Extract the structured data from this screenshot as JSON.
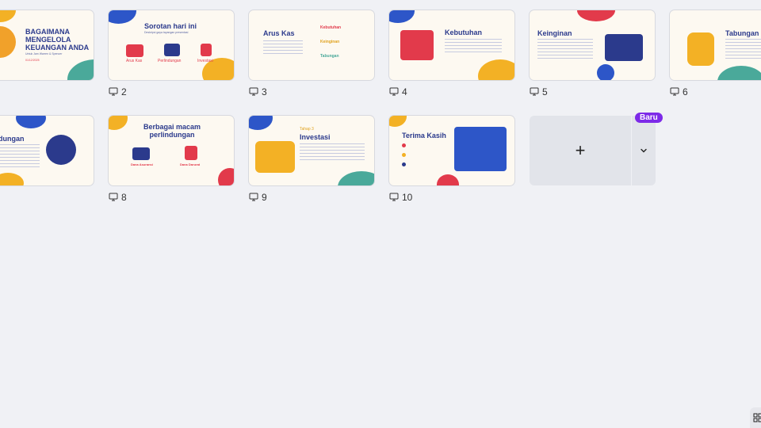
{
  "slides": [
    {
      "number": "",
      "title": "BAGAIMANA MENGELOLA KEUANGAN ANDA",
      "subtitle": "Untuk Jam Warren & Spencer",
      "date": "01/12/2025"
    },
    {
      "number": "2",
      "title": "Sorotan hari ini",
      "subtitle": "Deskripsi gaya tayangan presentasi",
      "labels": [
        "Arus Kas",
        "Perlindungan",
        "Investasi"
      ]
    },
    {
      "number": "3",
      "title": "Arus Kas",
      "labels": [
        "Kebutuhan",
        "Keinginan",
        "Tabungan"
      ]
    },
    {
      "number": "4",
      "title": "Kebutuhan"
    },
    {
      "number": "5",
      "title": "Keinginan"
    },
    {
      "number": "6",
      "title": "Tabungan"
    },
    {
      "number": "",
      "title": "dungan"
    },
    {
      "number": "8",
      "title": "Berbagai macam perlindungan",
      "labels": [
        "Dana Asuransi",
        "Dana Darurat"
      ]
    },
    {
      "number": "9",
      "step": "Tahap 3",
      "title": "Investasi"
    },
    {
      "number": "10",
      "title": "Terima Kasih"
    }
  ],
  "add_button": {
    "icon": "plus-icon",
    "label": "+"
  },
  "new_badge": "Baru"
}
